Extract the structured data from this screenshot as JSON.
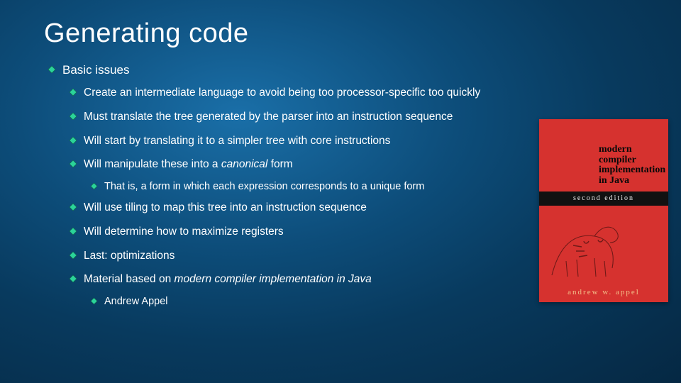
{
  "title": "Generating code",
  "bullets": {
    "l1": "Basic issues",
    "items": [
      "Create an intermediate language to avoid being too processor-specific too quickly",
      "Must translate the tree generated by the parser into an instruction sequence",
      "Will start by translating it to a simpler tree with core instructions",
      "Will manipulate these into a <em>canonical</em> form",
      "Will use tiling to map this tree into an instruction sequence",
      "Will determine how to maximize registers",
      "Last: optimizations",
      "Material based on <em>modern compiler implementation in Java</em>"
    ],
    "sub_of_3": "That is, a form in which each expression corresponds to a unique form",
    "sub_of_7": "Andrew Appel"
  },
  "book": {
    "title_lines": [
      "modern",
      "compiler",
      "implementation",
      "in Java"
    ],
    "edition": "second edition",
    "author": "andrew w. appel"
  },
  "colors": {
    "diamond_fill": "#2bd39a",
    "diamond_stroke": "#0f6b4c"
  }
}
